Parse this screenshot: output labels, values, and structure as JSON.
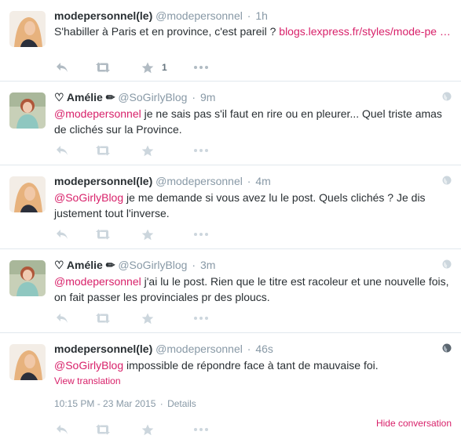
{
  "colors": {
    "link": "#d8216a",
    "muted": "#8899a6",
    "text": "#292f33",
    "icon": "#b1bbc3"
  },
  "tweets": [
    {
      "fullname": "modepersonnel(le)",
      "username": "@modepersonnel",
      "time": "1h",
      "text_plain": "S'habiller à Paris et en province, c'est pareil ? ",
      "link": "blogs.lexpress.fr/styles/mode-pe …",
      "fav_count": "1"
    },
    {
      "fullname": "♡ Amélie ✏",
      "username": "@SoGirlyBlog",
      "time": "9m",
      "mention": "@modepersonnel",
      "text_plain": " je ne sais pas s'il faut en rire ou en pleurer... Quel triste amas de clichés sur la Province."
    },
    {
      "fullname": "modepersonnel(le)",
      "username": "@modepersonnel",
      "time": "4m",
      "mention": "@SoGirlyBlog",
      "text_plain": " je me demande si vous avez lu le post. Quels clichés ? Je dis justement tout l'inverse."
    },
    {
      "fullname": "♡ Amélie ✏",
      "username": "@SoGirlyBlog",
      "time": "3m",
      "mention": "@modepersonnel",
      "text_plain": " j'ai lu le post. Rien que le titre est racoleur et une nouvelle fois, on fait passer les provinciales pr des ploucs."
    },
    {
      "fullname": "modepersonnel(le)",
      "username": "@modepersonnel",
      "time": "46s",
      "mention": "@SoGirlyBlog",
      "text_plain": " impossible de répondre face à tant de mauvaise foi.",
      "view_translation": "View translation",
      "timestamp": "10:15 PM - 23 Mar 2015",
      "details": "Details",
      "hide_conversation": "Hide conversation"
    }
  ],
  "icons": {
    "reply": "reply-icon",
    "retweet": "retweet-icon",
    "favorite": "star-icon",
    "more": "more-icon",
    "globe": "globe-icon"
  }
}
